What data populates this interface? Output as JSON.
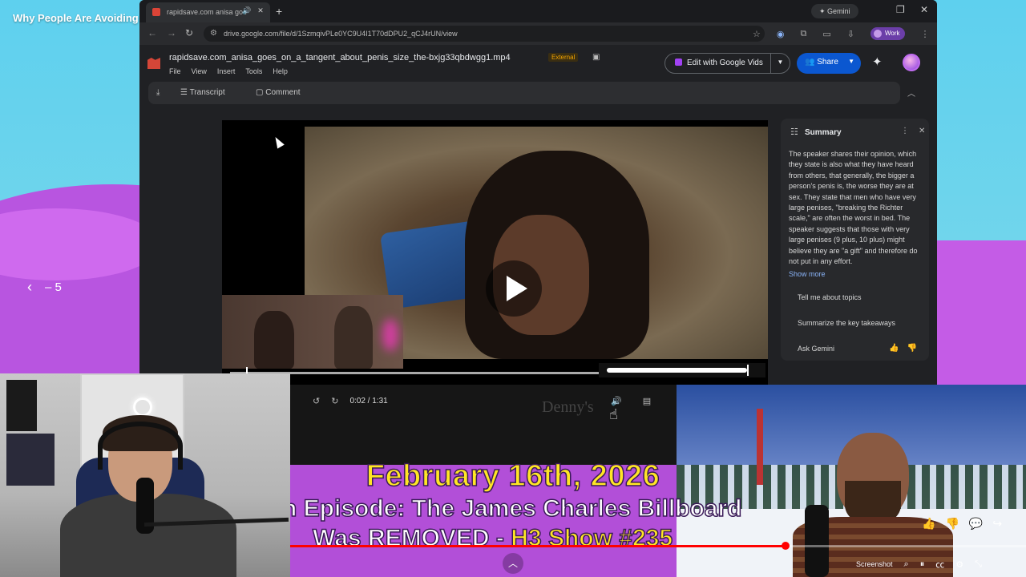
{
  "slide": {
    "title": "Why People Are Avoiding Relationships",
    "nav_prev": "‹",
    "nav_label": "– 5"
  },
  "browser": {
    "tab_title": "rapidsave.com anisa goe",
    "gemini_label": "Gemini",
    "url": "drive.google.com/file/d/1SzmqivPLe0YC9U4I1T70dDPU2_qCJ4rUN/view",
    "work_label": "Work"
  },
  "drive": {
    "filename": "rapidsave.com_anisa_goes_on_a_tangent_about_penis_size_the-bxjg33qbdwgg1.mp4",
    "external_badge": "External",
    "menu": [
      "File",
      "View",
      "Insert",
      "Tools",
      "Help"
    ],
    "edit_vids_label": "Edit with Google Vids",
    "share_label": "Share",
    "toolbar": {
      "transcript": "Transcript",
      "comment": "Comment"
    }
  },
  "summary": {
    "title": "Summary",
    "body": "The speaker shares their opinion, which they state is also what they have heard from others, that generally, the bigger a person's penis is, the worse they are at sex. They state that men who have very large penises, \"breaking the Richter scale,\" are often the worst in bed. The speaker suggests that those with very large penises (9 plus, 10 plus) might believe they are \"a gift\" and therefore do not put in any effort.",
    "show_more": "Show more",
    "suggestions": [
      "Tell me about topics",
      "Summarize the key takeaways",
      "Ask Gemini"
    ]
  },
  "video": {
    "time": "0:02 / 1:31",
    "overlay_text": "Denny's",
    "volume_level": 0.85
  },
  "h3": {
    "date": "February 16th, 2026",
    "episode_line1": "n Episode: The James Charles Billboard",
    "episode_line2_a": "Was REMOVED - ",
    "episode_line2_b": "H3 Show #235",
    "progress": 0.673
  },
  "yt_controls": {
    "screenshot_label": "Screenshot"
  }
}
